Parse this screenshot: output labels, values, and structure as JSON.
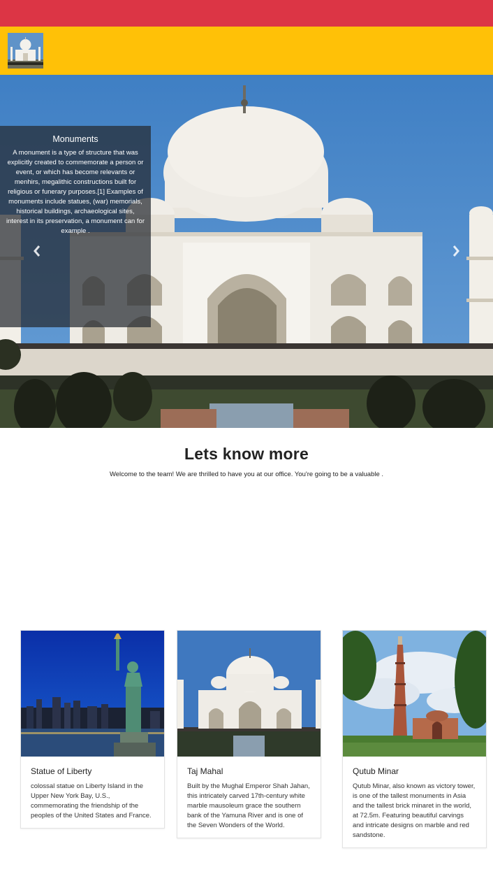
{
  "hero": {
    "caption_title": "Monuments",
    "caption_text": "A monument is a type of structure that was explicitly created to commemorate a person or event, or which has become relevants or menhirs, megalithic constructions built for religious or funerary purposes.[1] Examples of monuments include statues, (war) memorials, historical buildings, archaeological sites, interest in its preservation, a monument can for example ."
  },
  "intro": {
    "title": "Lets know more",
    "text": "Welcome to the team! We are thrilled to have you at our office. You're going to be a valuable ."
  },
  "cards": [
    {
      "title": "Statue of Liberty",
      "text": "colossal statue on Liberty Island in the Upper New York Bay, U.S., commemorating the friendship of the peoples of the United States and France."
    },
    {
      "title": "Taj Mahal",
      "text": "Built by the Mughal Emperor Shah Jahan, this intricately carved 17th-century white marble mausoleum grace the southern bank of the Yamuna River and is one of the Seven Wonders of the World."
    },
    {
      "title": "Qutub Minar",
      "text": "Qutub Minar, also known as victory tower, is one of the tallest monuments in Asia and the tallest brick minaret in the world, at 72.5m. Featuring beautiful carvings and intricate designs on marble and red sandstone."
    }
  ],
  "colors": {
    "topbar": "#dc3545",
    "navbar": "#ffc107",
    "caption_bg": "#262a30"
  },
  "icons": {
    "prev": "chevron-left-icon",
    "next": "chevron-right-icon"
  }
}
